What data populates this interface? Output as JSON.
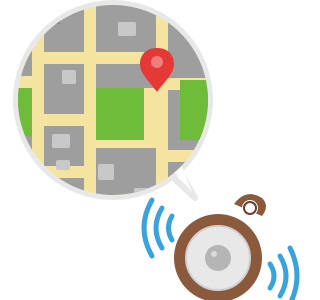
{
  "illustration": {
    "subject": "gps-tracker-sending-location-to-map",
    "colors": {
      "background": "#ffffff",
      "bubble_border": "#e8e8e8",
      "road": "#f5e3a0",
      "block": "#9e9e9e",
      "block_dark": "#888888",
      "building": "#c8c8c8",
      "park": "#6fbb3a",
      "pin": "#e53935",
      "tracker_body": "#8b5a3c",
      "tracker_face": "#e8e8e8",
      "tracker_button": "#b5b5b5",
      "signal": "#3aa3dc"
    }
  }
}
